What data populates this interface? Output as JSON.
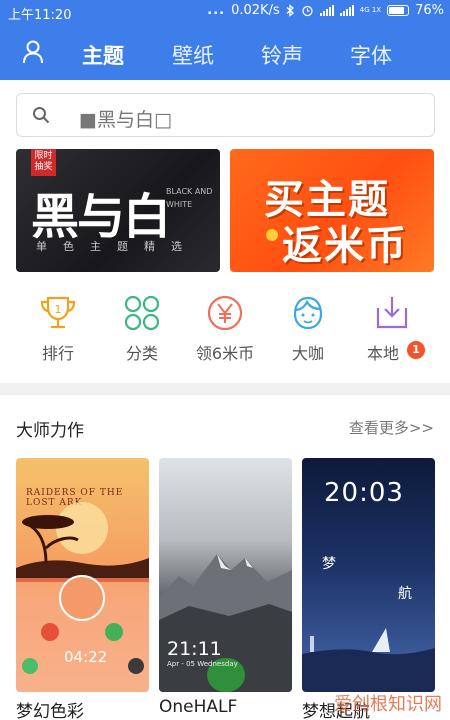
{
  "status_bar": {
    "time": "上午11:20",
    "dots": "...",
    "network_speed": "0.02K/s",
    "network_tag": "4G 1X",
    "battery": "76%"
  },
  "nav": {
    "tabs": [
      {
        "label": "主题",
        "active": true
      },
      {
        "label": "壁纸",
        "active": false
      },
      {
        "label": "铃声",
        "active": false
      },
      {
        "label": "字体",
        "active": false
      }
    ]
  },
  "search": {
    "value": "■黑与白□"
  },
  "banners": {
    "left": {
      "tag": "限时抽奖",
      "title": "黑与白",
      "side_text": "BLACK AND WHITE",
      "subtitle": "单色主题精选"
    },
    "right": {
      "line1": "买主题",
      "line2": "返米币"
    }
  },
  "categories": [
    {
      "label": "排行",
      "icon": "trophy-icon",
      "color": "#f0a31a"
    },
    {
      "label": "分类",
      "icon": "grid-icon",
      "color": "#3bb780"
    },
    {
      "label": "领6米币",
      "icon": "yen-coin-icon",
      "color": "#f26e57"
    },
    {
      "label": "大咖",
      "icon": "face-icon",
      "color": "#3aa8e8"
    },
    {
      "label": "本地",
      "icon": "download-icon",
      "color": "#9b6bd6",
      "badge": "1"
    }
  ],
  "section": {
    "title": "大师力作",
    "more": "查看更多>>"
  },
  "themes": [
    {
      "name": "梦幻色彩",
      "poster_title": "RAIDERS OF THE LOST ARK",
      "time": "04:22"
    },
    {
      "name": "OneHALF",
      "time": "21:11",
      "date": "Apr - 05 Wednesday"
    },
    {
      "name": "梦想起航",
      "time": "20:03"
    }
  ],
  "watermark": "爱创根知识网",
  "colors": {
    "header": "#3d7eea",
    "badge": "#f5532d"
  }
}
